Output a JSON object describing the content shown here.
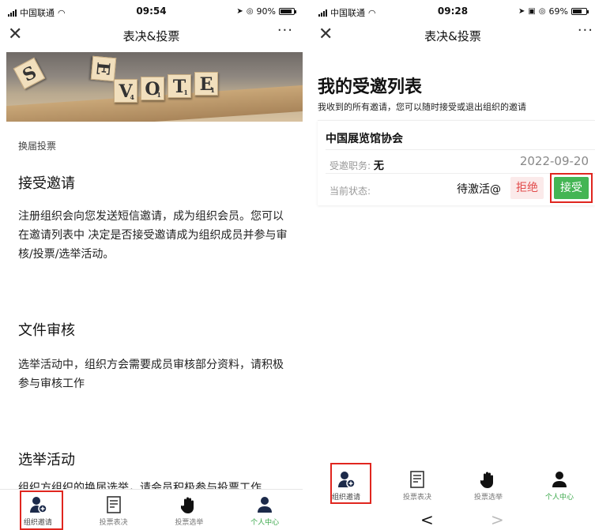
{
  "left": {
    "status": {
      "carrier": "中国联通",
      "time": "09:54",
      "battery": "90%",
      "battery_level": 0.9
    },
    "nav": {
      "title": "表决&投票",
      "close": "✕",
      "more": "···"
    },
    "banner": {
      "tiles": [
        {
          "letter": "S",
          "score": ""
        },
        {
          "letter": "E",
          "score": ""
        },
        {
          "letter": "V",
          "score": "4"
        },
        {
          "letter": "O",
          "score": "1"
        },
        {
          "letter": "T",
          "score": "1"
        },
        {
          "letter": "E",
          "score": "1"
        }
      ]
    },
    "breadcrumb": "换届投票",
    "sections": [
      {
        "heading": "接受邀请",
        "body": "注册组织会向您发送短信邀请，成为组织会员。您可以在邀请列表中 决定是否接受邀请成为组织成员并参与审核/投票/选举活动。"
      },
      {
        "heading": "文件审核",
        "body": "选举活动中，组织方会需要成员审核部分资料，请积极参与审核工作"
      },
      {
        "heading": "选举活动",
        "body": "组织方组织的换届选举，请会员积极参与投票工作"
      }
    ]
  },
  "right": {
    "status": {
      "carrier": "中国联通",
      "time": "09:28",
      "battery": "69%",
      "battery_level": 0.69
    },
    "nav": {
      "title": "表决&投票",
      "close": "✕",
      "more": "···"
    },
    "page_title": "我的受邀列表",
    "subtitle": "我收到的所有邀请，您可以随时接受或退出组织的邀请",
    "invitation": {
      "org": "中国展览馆协会",
      "position_label": "受邀职务:",
      "position_value": "无",
      "date": "2022-09-20",
      "status_label": "当前状态:",
      "status_value": "待激活@",
      "reject": "拒绝",
      "accept": "接受"
    },
    "browser": {
      "back": "<",
      "forward": ">"
    }
  },
  "tabs": [
    "组织邀请",
    "投票表决",
    "投票选举",
    "个人中心"
  ],
  "colors": {
    "accent_green": "#44b554",
    "highlight_red": "#e0261f",
    "reject_red": "#e24b4b"
  }
}
